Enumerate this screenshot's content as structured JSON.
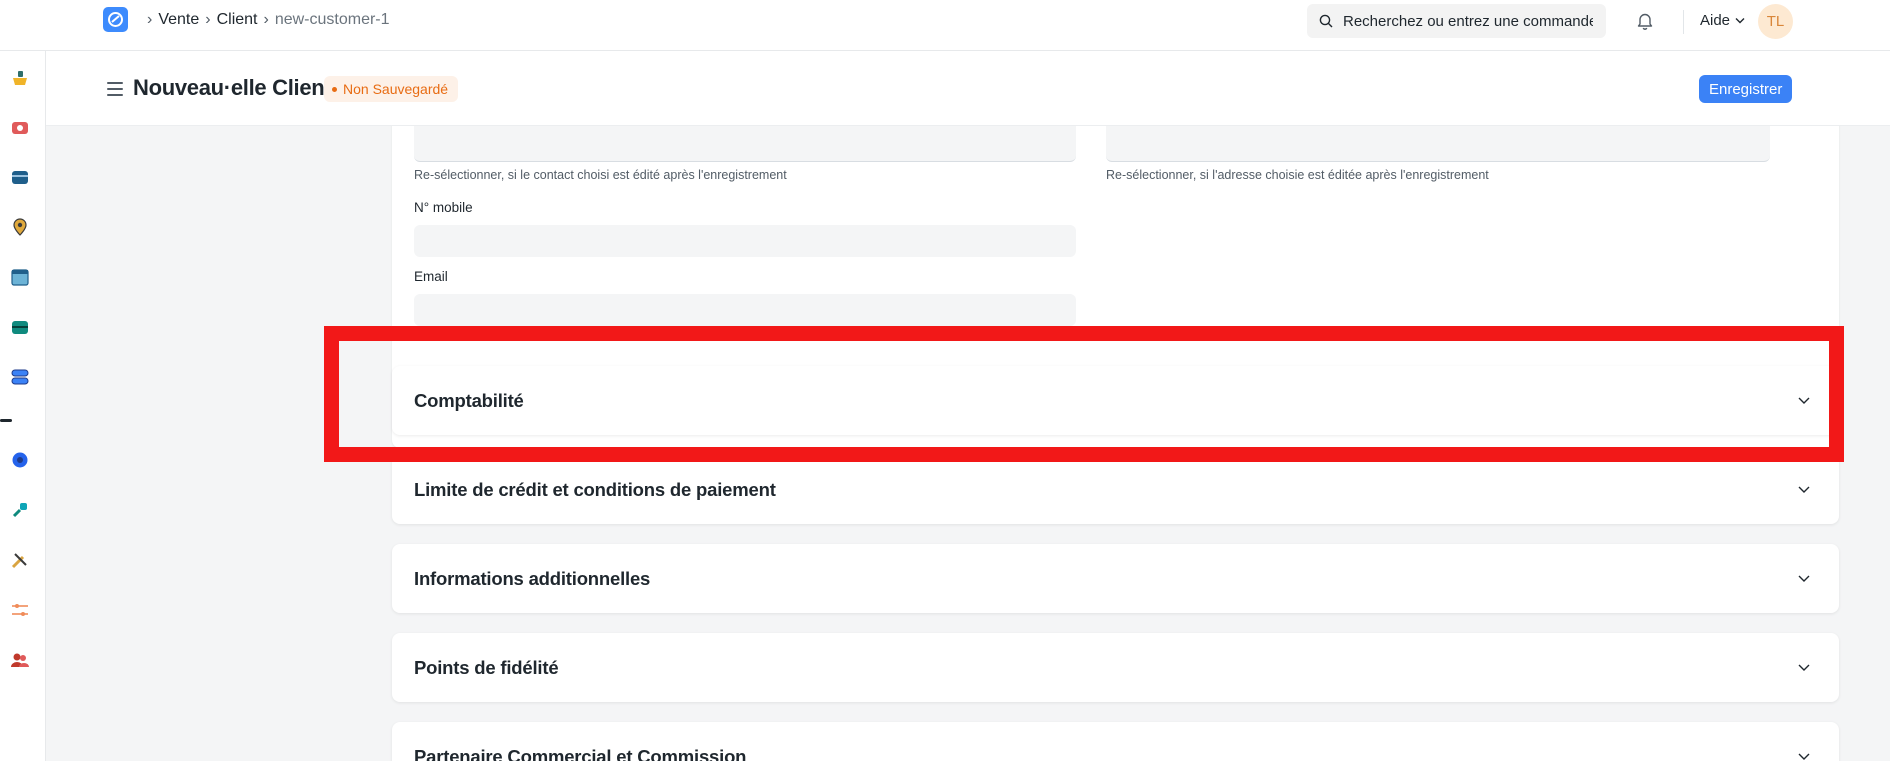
{
  "navbar": {
    "breadcrumbs": [
      "Vente",
      "Client",
      "new-customer-1"
    ],
    "search_placeholder": "Recherchez ou entrez une commande",
    "help_label": "Aide",
    "avatar_initials": "TL"
  },
  "page": {
    "title": "Nouveau·elle Client",
    "status_badge": "Non Sauvegardé",
    "save_label": "Enregistrer"
  },
  "contact_section": {
    "contact_reselect_hint": "Re-sélectionner, si le contact choisi est édité après l'enregistrement",
    "address_reselect_hint": "Re-sélectionner, si l'adresse choisie est éditée après l'enregistrement",
    "mobile_label": "N° mobile",
    "mobile_value": "",
    "email_label": "Email",
    "email_value": ""
  },
  "sections": [
    {
      "title": "Comptabilité"
    },
    {
      "title": "Limite de crédit et conditions de paiement"
    },
    {
      "title": "Informations additionnelles"
    },
    {
      "title": "Points de fidélité"
    },
    {
      "title": "Partenaire Commercial et Commission"
    }
  ],
  "colors": {
    "primary": "#3b82f6",
    "badge_text": "#e86c13",
    "badge_bg": "#fdf1e8",
    "highlight": "#f21818"
  }
}
